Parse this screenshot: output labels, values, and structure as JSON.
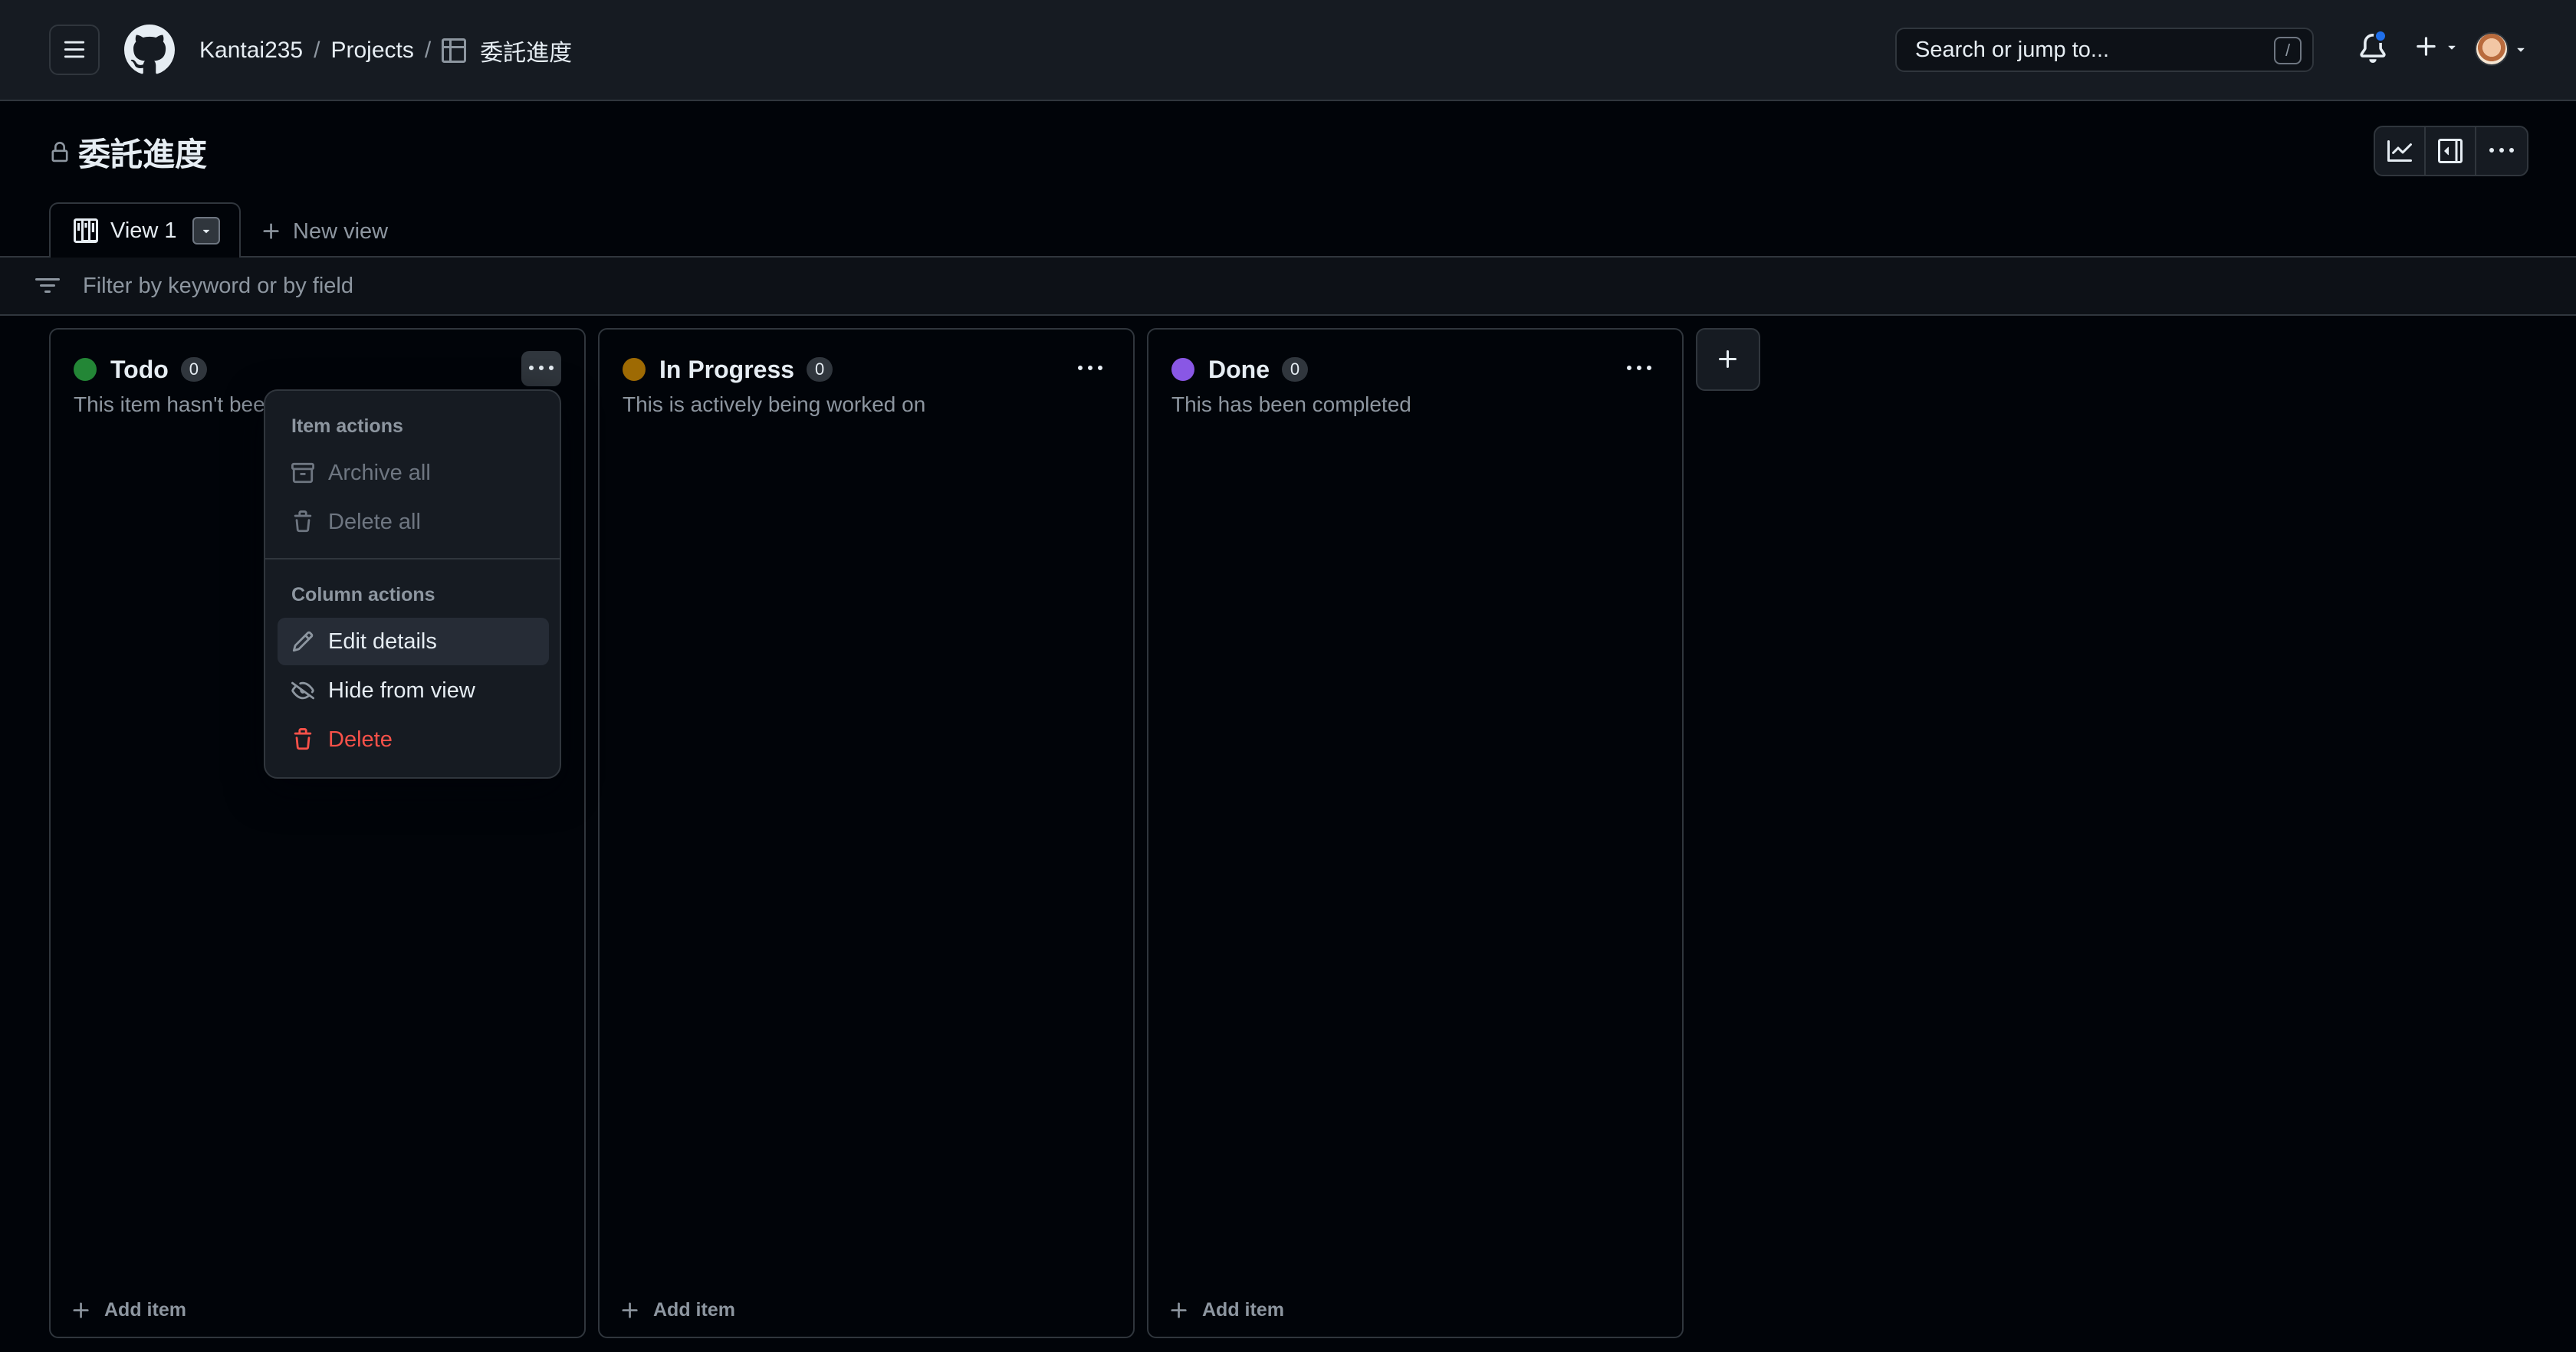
{
  "header": {
    "breadcrumb": {
      "owner": "Kantai235",
      "section": "Projects",
      "project": "委託進度"
    },
    "search_placeholder": "Search or jump to...",
    "search_shortcut": "/"
  },
  "project": {
    "title": "委託進度"
  },
  "views": {
    "active_tab": "View 1",
    "new_view_label": "New view"
  },
  "filter": {
    "placeholder": "Filter by keyword or by field"
  },
  "columns": [
    {
      "title": "Todo",
      "count": "0",
      "description": "This item hasn't been started",
      "color": "#238636",
      "add_label": "Add item"
    },
    {
      "title": "In Progress",
      "count": "0",
      "description": "This is actively being worked on",
      "color": "#9e6a03",
      "add_label": "Add item"
    },
    {
      "title": "Done",
      "count": "0",
      "description": "This has been completed",
      "color": "#8957e5",
      "add_label": "Add item"
    }
  ],
  "menu": {
    "item_actions_title": "Item actions",
    "archive_all": "Archive all",
    "delete_all": "Delete all",
    "column_actions_title": "Column actions",
    "edit_details": "Edit details",
    "hide_from_view": "Hide from view",
    "delete": "Delete"
  }
}
